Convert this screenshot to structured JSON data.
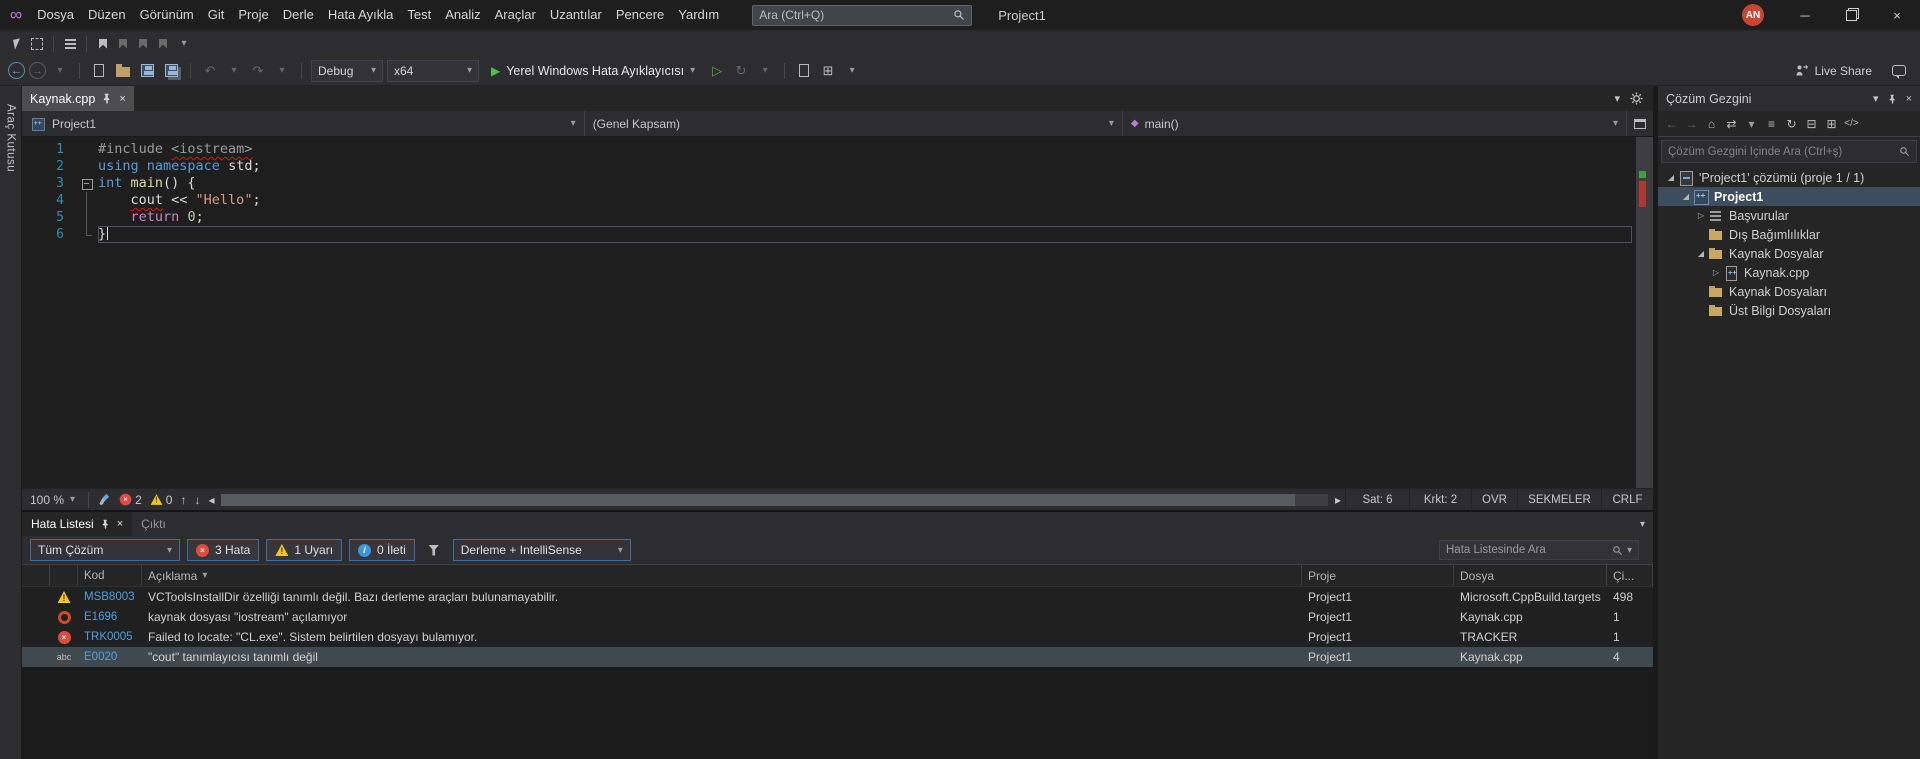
{
  "title_bar": {
    "menus": [
      "Dosya",
      "Düzen",
      "Görünüm",
      "Git",
      "Proje",
      "Derle",
      "Hata Ayıkla",
      "Test",
      "Analiz",
      "Araçlar",
      "Uzantılar",
      "Pencere",
      "Yardım"
    ],
    "search_placeholder": "Ara (Ctrl+Q)",
    "project_label": "Project1",
    "avatar_initials": "AN"
  },
  "toolbar": {
    "config": "Debug",
    "platform": "x64",
    "run_button": "Yerel Windows Hata Ayıklayıcısı",
    "live_share": "Live Share"
  },
  "toolbox_strip": {
    "label": "Araç Kutusu"
  },
  "editor": {
    "tab_title": "Kaynak.cpp",
    "nav_project": "Project1",
    "nav_scope": "(Genel Kapsam)",
    "nav_member": "main()",
    "lines": [
      {
        "n": "1",
        "segments": [
          {
            "t": "#include ",
            "c": "pp"
          },
          {
            "t": "<iostream>",
            "c": "pp",
            "sq": true
          }
        ]
      },
      {
        "n": "2",
        "segments": [
          {
            "t": "using",
            "c": "kw"
          },
          {
            "t": " ",
            "c": "pl"
          },
          {
            "t": "namespace",
            "c": "kw"
          },
          {
            "t": " std;",
            "c": "pl"
          }
        ]
      },
      {
        "n": "3",
        "outline": "box",
        "segments": [
          {
            "t": "int",
            "c": "kw"
          },
          {
            "t": " ",
            "c": "pl"
          },
          {
            "t": "main",
            "c": "fn"
          },
          {
            "t": "() {",
            "c": "pl"
          }
        ]
      },
      {
        "n": "4",
        "outline": "bar",
        "segments": [
          {
            "t": "    ",
            "c": "pl"
          },
          {
            "t": "cout",
            "c": "pl",
            "sq": true
          },
          {
            "t": " << ",
            "c": "pl"
          },
          {
            "t": "\"Hello\"",
            "c": "str"
          },
          {
            "t": ";",
            "c": "pl"
          }
        ]
      },
      {
        "n": "5",
        "outline": "bar",
        "segments": [
          {
            "t": "    ",
            "c": "pl"
          },
          {
            "t": "return",
            "c": "ctrl"
          },
          {
            "t": " ",
            "c": "pl"
          },
          {
            "t": "0",
            "c": "num"
          },
          {
            "t": ";",
            "c": "pl"
          }
        ]
      },
      {
        "n": "6",
        "outline": "end",
        "current": true,
        "caret": true,
        "segments": [
          {
            "t": "}",
            "c": "pl"
          }
        ]
      }
    ],
    "zoom": "100 %",
    "error_count": "2",
    "warning_count": "0",
    "line_status": "Sat: 6",
    "col_status": "Krkt: 2",
    "ins_mode": "OVR",
    "tabs_mode": "SEKMELER",
    "eol": "CRLF"
  },
  "error_list": {
    "tab_error": "Hata Listesi",
    "tab_output": "Çıktı",
    "scope": "Tüm Çözüm",
    "errors_label": "3 Hata",
    "warnings_label": "1 Uyarı",
    "messages_label": "0 İleti",
    "source": "Derleme + IntelliSense",
    "search_placeholder": "Hata Listesinde Ara",
    "col_code": "Kod",
    "col_desc": "Açıklama",
    "col_project": "Proje",
    "col_file": "Dosya",
    "col_line": "Çi...",
    "rows": [
      {
        "sev": "warning",
        "code": "MSB8003",
        "desc": "VCToolsInstallDir özelliği tanımlı değil. Bazı derleme araçları bulunamayabilir.",
        "project": "Project1",
        "file": "Microsoft.CppBuild.targets",
        "line": "498"
      },
      {
        "sev": "ring",
        "code": "E1696",
        "desc": "kaynak dosyası \"iostream\" açılamıyor",
        "project": "Project1",
        "file": "Kaynak.cpp",
        "line": "1"
      },
      {
        "sev": "error",
        "code": "TRK0005",
        "desc": "Failed to locate: \"CL.exe\". Sistem belirtilen dosyayı bulamıyor.",
        "project": "Project1",
        "file": "TRACKER",
        "line": "1"
      },
      {
        "sev": "abc",
        "code": "E0020",
        "desc": "\"cout\" tanımlayıcısı tanımlı değil",
        "project": "Project1",
        "file": "Kaynak.cpp",
        "line": "4",
        "selected": true
      }
    ]
  },
  "solution_explorer": {
    "title": "Çözüm Gezgini",
    "search_placeholder": "Çözüm Gezgini İçinde Ara (Ctrl+ş)",
    "tree": [
      {
        "label": "'Project1' çözümü (proje 1 / 1)",
        "level": 0,
        "exp": "open",
        "icon": "solution"
      },
      {
        "label": "Project1",
        "level": 1,
        "exp": "open",
        "icon": "cppproj",
        "selected": true,
        "bold": true
      },
      {
        "label": "Başvurular",
        "level": 2,
        "exp": "closed",
        "icon": "references"
      },
      {
        "label": "Dış Bağımlılıklar",
        "level": 2,
        "icon": "folder"
      },
      {
        "label": "Kaynak Dosyalar",
        "level": 2,
        "exp": "open",
        "icon": "folder"
      },
      {
        "label": "Kaynak.cpp",
        "level": 3,
        "exp": "closed",
        "icon": "cppfile"
      },
      {
        "label": "Kaynak Dosyaları",
        "level": 2,
        "icon": "folder"
      },
      {
        "label": "Üst Bilgi Dosyaları",
        "level": 2,
        "icon": "folder"
      }
    ]
  },
  "icons": {
    "logo": "∞",
    "chevron_down": "▾",
    "close": "×",
    "minimize": "─",
    "back": "←",
    "forward": "→",
    "undo": "↶",
    "redo": "↷",
    "play": "▶",
    "play_outline": "▷",
    "up": "↑",
    "down": "↓",
    "scroll_left": "◂",
    "scroll_right": "▸",
    "home": "⌂",
    "refresh": "↻",
    "sync": "⇄",
    "collapse_all": "⊟",
    "show_all": "⊞",
    "list": "≡",
    "code_view": "</>",
    "expander_open": "◢",
    "expander_closed": "▷",
    "method_cube": "◆"
  }
}
